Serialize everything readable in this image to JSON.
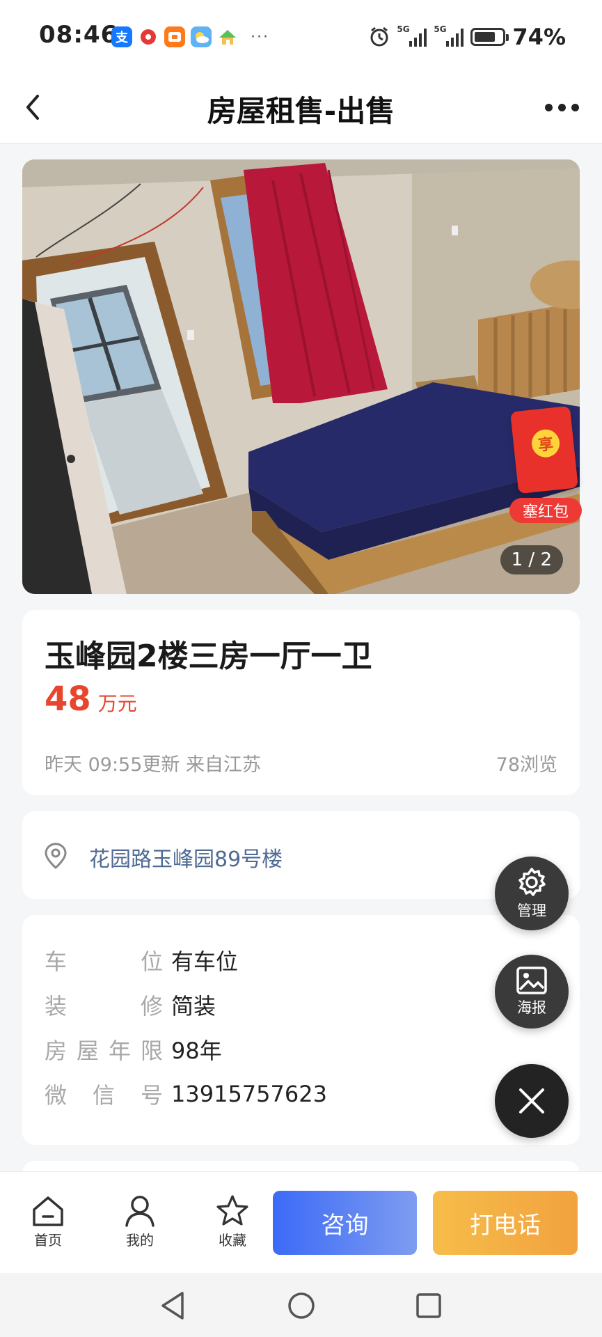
{
  "status_bar": {
    "time": "08:46",
    "battery": "74%",
    "network_1": "5G",
    "network_2": "5G",
    "app_icons": [
      "alipay-icon",
      "record-icon",
      "wallet-icon",
      "weather-icon",
      "home-app-icon"
    ]
  },
  "nav": {
    "title": "房屋租售-出售"
  },
  "photo": {
    "counter": "1 / 2"
  },
  "red_packet": {
    "coin_text": "享",
    "label": "塞红包"
  },
  "listing": {
    "title": "玉峰园2楼三房一厅一卫",
    "price": "48",
    "price_unit": "万元",
    "updated": "昨天 09:55更新 来自江苏",
    "views": "78浏览"
  },
  "address": {
    "text": "花园路玉峰园89号楼"
  },
  "attributes": [
    {
      "label_chars": [
        "车",
        "位"
      ],
      "value": "有车位"
    },
    {
      "label_chars": [
        "装",
        "修"
      ],
      "value": "简装"
    },
    {
      "label_chars": [
        "房",
        "屋",
        "年",
        "限"
      ],
      "value": "98年"
    },
    {
      "label_chars": [
        "微",
        "信",
        "号"
      ],
      "value": "13915757623"
    }
  ],
  "fab": {
    "manage": "管理",
    "poster": "海报"
  },
  "bottom_bar": {
    "home": "首页",
    "mine": "我的",
    "favorite": "收藏",
    "consult": "咨询",
    "call": "打电话"
  },
  "colors": {
    "price_red": "#e8452f",
    "address_blue": "#4f6a94",
    "consult_blue": "#3b6af7",
    "call_orange": "#f2a23e"
  }
}
